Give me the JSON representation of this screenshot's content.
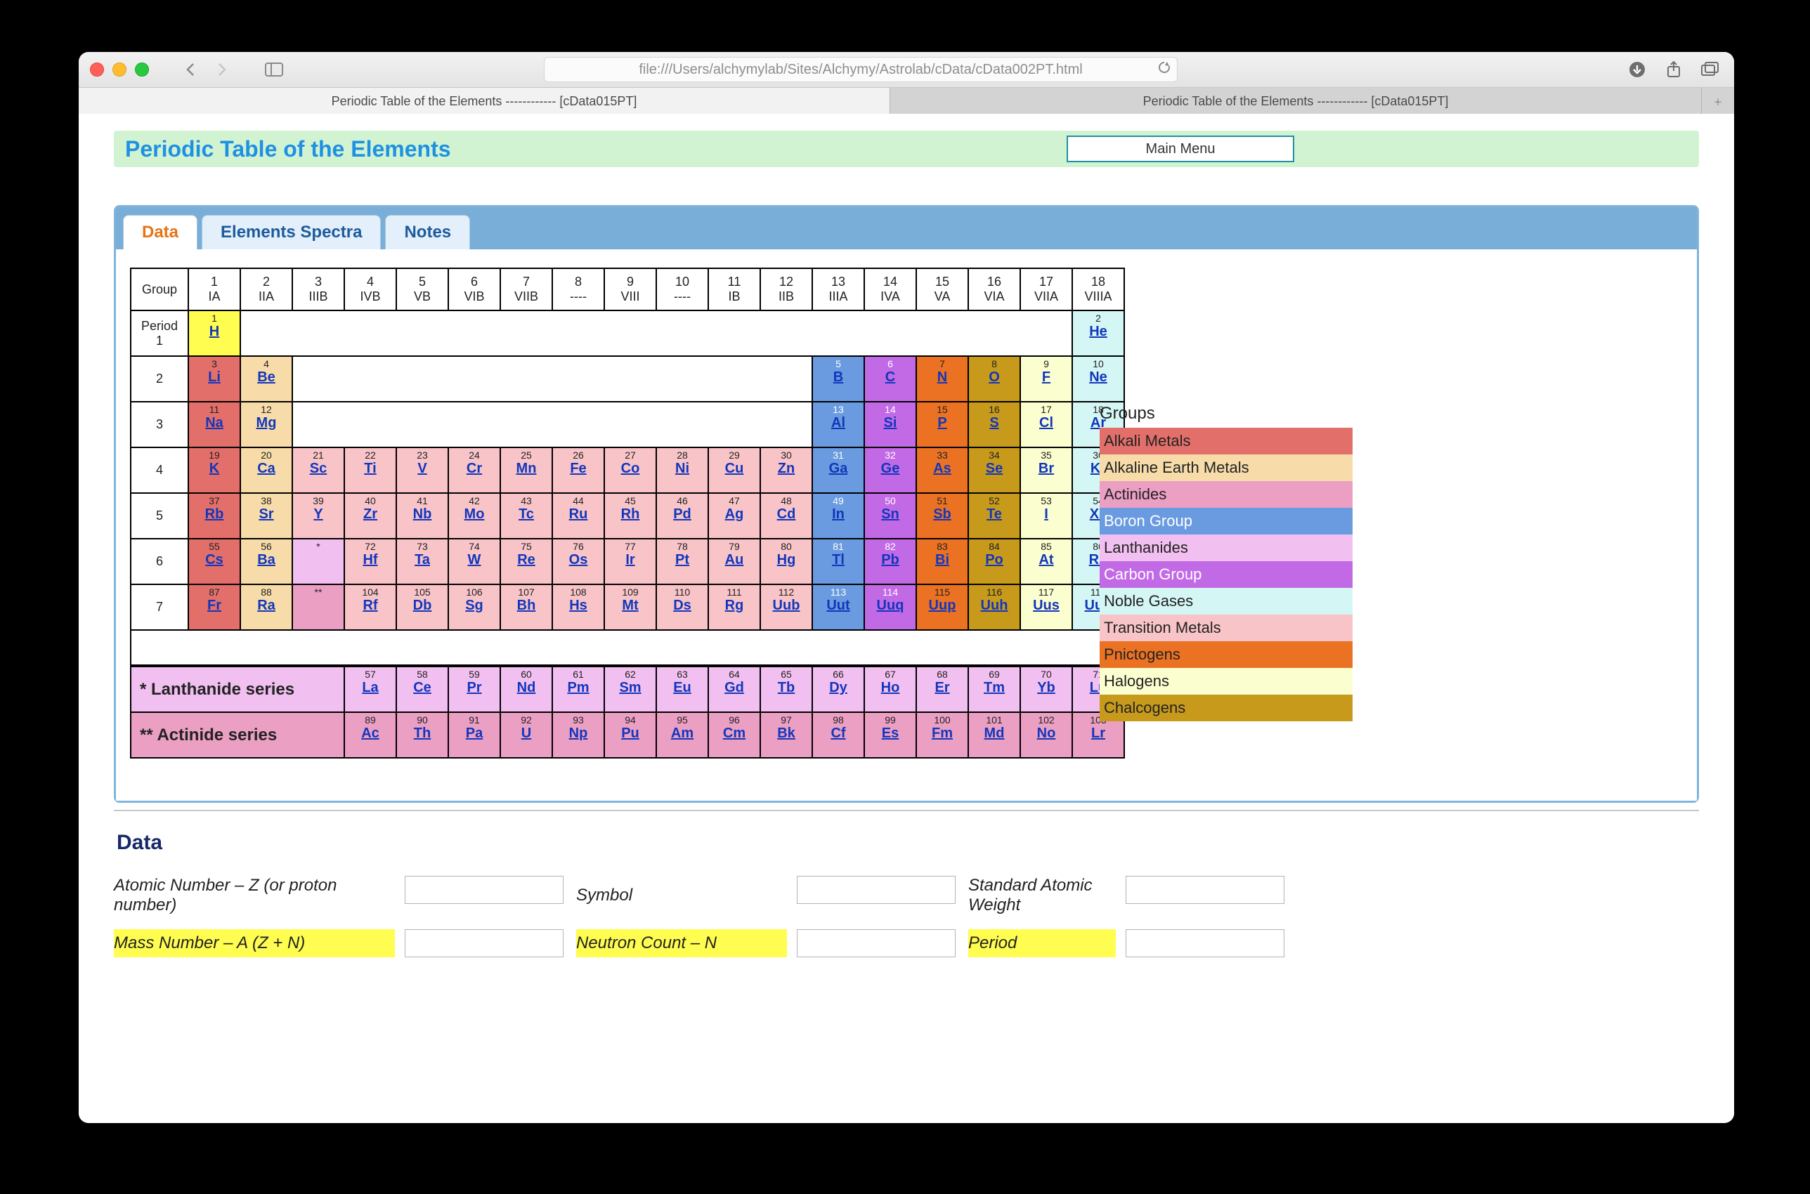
{
  "browser": {
    "url": "file:///Users/alchymylab/Sites/Alchymy/Astrolab/cData/cData002PT.html",
    "tabs": [
      "Periodic Table of the Elements ------------ [cData015PT]",
      "Periodic Table of the Elements ------------ [cData015PT]"
    ]
  },
  "page": {
    "title": "Periodic Table of the Elements",
    "main_menu": "Main Menu",
    "tabs": {
      "data": "Data",
      "spectra": "Elements Spectra",
      "notes": "Notes"
    },
    "group_header_label": "Group",
    "period_header_prefix": "Period",
    "groups": [
      {
        "n": "1",
        "r": "IA"
      },
      {
        "n": "2",
        "r": "IIA"
      },
      {
        "n": "3",
        "r": "IIIB"
      },
      {
        "n": "4",
        "r": "IVB"
      },
      {
        "n": "5",
        "r": "VB"
      },
      {
        "n": "6",
        "r": "VIB"
      },
      {
        "n": "7",
        "r": "VIIB"
      },
      {
        "n": "8",
        "r": "----"
      },
      {
        "n": "9",
        "r": "VIII"
      },
      {
        "n": "10",
        "r": "----"
      },
      {
        "n": "11",
        "r": "IB"
      },
      {
        "n": "12",
        "r": "IIB"
      },
      {
        "n": "13",
        "r": "IIIA"
      },
      {
        "n": "14",
        "r": "IVA"
      },
      {
        "n": "15",
        "r": "VA"
      },
      {
        "n": "16",
        "r": "VIA"
      },
      {
        "n": "17",
        "r": "VIIA"
      },
      {
        "n": "18",
        "r": "VIIIA"
      }
    ],
    "periods": [
      "1",
      "2",
      "3",
      "4",
      "5",
      "6",
      "7"
    ],
    "rows": [
      [
        {
          "z": 1,
          "s": "H",
          "c": "c-h"
        },
        null,
        null,
        null,
        null,
        null,
        null,
        null,
        null,
        null,
        null,
        null,
        null,
        null,
        null,
        null,
        null,
        {
          "z": 2,
          "s": "He",
          "c": "c-ng"
        }
      ],
      [
        {
          "z": 3,
          "s": "Li",
          "c": "c-am"
        },
        {
          "z": 4,
          "s": "Be",
          "c": "c-aem"
        },
        null,
        null,
        null,
        null,
        null,
        null,
        null,
        null,
        null,
        null,
        {
          "z": 5,
          "s": "B",
          "c": "c-bg"
        },
        {
          "z": 6,
          "s": "C",
          "c": "c-cg"
        },
        {
          "z": 7,
          "s": "N",
          "c": "c-pn"
        },
        {
          "z": 8,
          "s": "O",
          "c": "c-ch"
        },
        {
          "z": 9,
          "s": "F",
          "c": "c-hal"
        },
        {
          "z": 10,
          "s": "Ne",
          "c": "c-ng"
        }
      ],
      [
        {
          "z": 11,
          "s": "Na",
          "c": "c-am"
        },
        {
          "z": 12,
          "s": "Mg",
          "c": "c-aem"
        },
        null,
        null,
        null,
        null,
        null,
        null,
        null,
        null,
        null,
        null,
        {
          "z": 13,
          "s": "Al",
          "c": "c-bg"
        },
        {
          "z": 14,
          "s": "Si",
          "c": "c-cg"
        },
        {
          "z": 15,
          "s": "P",
          "c": "c-pn"
        },
        {
          "z": 16,
          "s": "S",
          "c": "c-ch"
        },
        {
          "z": 17,
          "s": "Cl",
          "c": "c-hal"
        },
        {
          "z": 18,
          "s": "Ar",
          "c": "c-ng"
        }
      ],
      [
        {
          "z": 19,
          "s": "K",
          "c": "c-am"
        },
        {
          "z": 20,
          "s": "Ca",
          "c": "c-aem"
        },
        {
          "z": 21,
          "s": "Sc",
          "c": "c-tm"
        },
        {
          "z": 22,
          "s": "Ti",
          "c": "c-tm"
        },
        {
          "z": 23,
          "s": "V",
          "c": "c-tm"
        },
        {
          "z": 24,
          "s": "Cr",
          "c": "c-tm"
        },
        {
          "z": 25,
          "s": "Mn",
          "c": "c-tm"
        },
        {
          "z": 26,
          "s": "Fe",
          "c": "c-tm"
        },
        {
          "z": 27,
          "s": "Co",
          "c": "c-tm"
        },
        {
          "z": 28,
          "s": "Ni",
          "c": "c-tm"
        },
        {
          "z": 29,
          "s": "Cu",
          "c": "c-tm"
        },
        {
          "z": 30,
          "s": "Zn",
          "c": "c-tm"
        },
        {
          "z": 31,
          "s": "Ga",
          "c": "c-bg"
        },
        {
          "z": 32,
          "s": "Ge",
          "c": "c-cg"
        },
        {
          "z": 33,
          "s": "As",
          "c": "c-pn"
        },
        {
          "z": 34,
          "s": "Se",
          "c": "c-ch"
        },
        {
          "z": 35,
          "s": "Br",
          "c": "c-hal"
        },
        {
          "z": 36,
          "s": "Kr",
          "c": "c-ng"
        }
      ],
      [
        {
          "z": 37,
          "s": "Rb",
          "c": "c-am"
        },
        {
          "z": 38,
          "s": "Sr",
          "c": "c-aem"
        },
        {
          "z": 39,
          "s": "Y",
          "c": "c-tm"
        },
        {
          "z": 40,
          "s": "Zr",
          "c": "c-tm"
        },
        {
          "z": 41,
          "s": "Nb",
          "c": "c-tm"
        },
        {
          "z": 42,
          "s": "Mo",
          "c": "c-tm"
        },
        {
          "z": 43,
          "s": "Tc",
          "c": "c-tm"
        },
        {
          "z": 44,
          "s": "Ru",
          "c": "c-tm"
        },
        {
          "z": 45,
          "s": "Rh",
          "c": "c-tm"
        },
        {
          "z": 46,
          "s": "Pd",
          "c": "c-tm"
        },
        {
          "z": 47,
          "s": "Ag",
          "c": "c-tm"
        },
        {
          "z": 48,
          "s": "Cd",
          "c": "c-tm"
        },
        {
          "z": 49,
          "s": "In",
          "c": "c-bg"
        },
        {
          "z": 50,
          "s": "Sn",
          "c": "c-cg"
        },
        {
          "z": 51,
          "s": "Sb",
          "c": "c-pn"
        },
        {
          "z": 52,
          "s": "Te",
          "c": "c-ch"
        },
        {
          "z": 53,
          "s": "I",
          "c": "c-hal"
        },
        {
          "z": 54,
          "s": "Xe",
          "c": "c-ng"
        }
      ],
      [
        {
          "z": 55,
          "s": "Cs",
          "c": "c-am"
        },
        {
          "z": 56,
          "s": "Ba",
          "c": "c-aem"
        },
        {
          "ast": "*",
          "c": "c-la"
        },
        {
          "z": 72,
          "s": "Hf",
          "c": "c-tm"
        },
        {
          "z": 73,
          "s": "Ta",
          "c": "c-tm"
        },
        {
          "z": 74,
          "s": "W",
          "c": "c-tm"
        },
        {
          "z": 75,
          "s": "Re",
          "c": "c-tm"
        },
        {
          "z": 76,
          "s": "Os",
          "c": "c-tm"
        },
        {
          "z": 77,
          "s": "Ir",
          "c": "c-tm"
        },
        {
          "z": 78,
          "s": "Pt",
          "c": "c-tm"
        },
        {
          "z": 79,
          "s": "Au",
          "c": "c-tm"
        },
        {
          "z": 80,
          "s": "Hg",
          "c": "c-tm"
        },
        {
          "z": 81,
          "s": "Tl",
          "c": "c-bg"
        },
        {
          "z": 82,
          "s": "Pb",
          "c": "c-cg"
        },
        {
          "z": 83,
          "s": "Bi",
          "c": "c-pn"
        },
        {
          "z": 84,
          "s": "Po",
          "c": "c-ch"
        },
        {
          "z": 85,
          "s": "At",
          "c": "c-hal"
        },
        {
          "z": 86,
          "s": "Rn",
          "c": "c-ng"
        }
      ],
      [
        {
          "z": 87,
          "s": "Fr",
          "c": "c-am"
        },
        {
          "z": 88,
          "s": "Ra",
          "c": "c-aem"
        },
        {
          "ast": "**",
          "c": "c-ac"
        },
        {
          "z": 104,
          "s": "Rf",
          "c": "c-tm"
        },
        {
          "z": 105,
          "s": "Db",
          "c": "c-tm"
        },
        {
          "z": 106,
          "s": "Sg",
          "c": "c-tm"
        },
        {
          "z": 107,
          "s": "Bh",
          "c": "c-tm"
        },
        {
          "z": 108,
          "s": "Hs",
          "c": "c-tm"
        },
        {
          "z": 109,
          "s": "Mt",
          "c": "c-tm"
        },
        {
          "z": 110,
          "s": "Ds",
          "c": "c-tm"
        },
        {
          "z": 111,
          "s": "Rg",
          "c": "c-tm"
        },
        {
          "z": 112,
          "s": "Uub",
          "c": "c-tm"
        },
        {
          "z": 113,
          "s": "Uut",
          "c": "c-bg"
        },
        {
          "z": 114,
          "s": "Uuq",
          "c": "c-cg"
        },
        {
          "z": 115,
          "s": "Uup",
          "c": "c-pn"
        },
        {
          "z": 116,
          "s": "Uuh",
          "c": "c-ch"
        },
        {
          "z": 117,
          "s": "Uus",
          "c": "c-hal"
        },
        {
          "z": 118,
          "s": "Uuo",
          "c": "c-ng"
        }
      ]
    ],
    "series": [
      {
        "label": "* Lanthanide series",
        "class": "c-la",
        "cells": [
          {
            "z": 57,
            "s": "La"
          },
          {
            "z": 58,
            "s": "Ce"
          },
          {
            "z": 59,
            "s": "Pr"
          },
          {
            "z": 60,
            "s": "Nd"
          },
          {
            "z": 61,
            "s": "Pm"
          },
          {
            "z": 62,
            "s": "Sm"
          },
          {
            "z": 63,
            "s": "Eu"
          },
          {
            "z": 64,
            "s": "Gd"
          },
          {
            "z": 65,
            "s": "Tb"
          },
          {
            "z": 66,
            "s": "Dy"
          },
          {
            "z": 67,
            "s": "Ho"
          },
          {
            "z": 68,
            "s": "Er"
          },
          {
            "z": 69,
            "s": "Tm"
          },
          {
            "z": 70,
            "s": "Yb"
          },
          {
            "z": 71,
            "s": "Lu"
          }
        ]
      },
      {
        "label": "** Actinide series",
        "class": "c-ac",
        "cells": [
          {
            "z": 89,
            "s": "Ac"
          },
          {
            "z": 90,
            "s": "Th"
          },
          {
            "z": 91,
            "s": "Pa"
          },
          {
            "z": 92,
            "s": "U"
          },
          {
            "z": 93,
            "s": "Np"
          },
          {
            "z": 94,
            "s": "Pu"
          },
          {
            "z": 95,
            "s": "Am"
          },
          {
            "z": 96,
            "s": "Cm"
          },
          {
            "z": 97,
            "s": "Bk"
          },
          {
            "z": 98,
            "s": "Cf"
          },
          {
            "z": 99,
            "s": "Es"
          },
          {
            "z": 100,
            "s": "Fm"
          },
          {
            "z": 101,
            "s": "Md"
          },
          {
            "z": 102,
            "s": "No"
          },
          {
            "z": 103,
            "s": "Lr"
          }
        ]
      }
    ],
    "legend_title": "Groups",
    "legend": [
      {
        "l": "Alkali Metals",
        "c": "c-am"
      },
      {
        "l": "Alkaline Earth Metals",
        "c": "c-aem"
      },
      {
        "l": "Actinides",
        "c": "c-ac"
      },
      {
        "l": "Boron Group",
        "c": "c-bg"
      },
      {
        "l": "Lanthanides",
        "c": "c-la"
      },
      {
        "l": "Carbon Group",
        "c": "c-cg"
      },
      {
        "l": "Noble Gases",
        "c": "c-ng"
      },
      {
        "l": "Transition Metals",
        "c": "c-tm"
      },
      {
        "l": "Pnictogens",
        "c": "c-pn"
      },
      {
        "l": "Halogens",
        "c": "c-hal"
      },
      {
        "l": "Chalcogens",
        "c": "c-ch"
      }
    ],
    "data_section": {
      "title": "Data",
      "rows": [
        [
          {
            "l": "Atomic Number – Z (or proton number)"
          },
          {
            "l": "Symbol"
          },
          {
            "l": "Standard Atomic Weight"
          }
        ],
        [
          {
            "l": "Mass Number – A (Z + N)",
            "hl": true
          },
          {
            "l": "Neutron Count – N",
            "hl": true
          },
          {
            "l": "Period",
            "hl": true
          }
        ]
      ]
    }
  }
}
